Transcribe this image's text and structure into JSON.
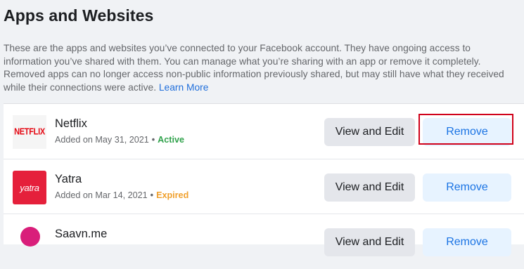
{
  "page": {
    "title": "Apps and Websites",
    "description": "These are the apps and websites you’ve connected to your Facebook account. They have ongoing access to information you’ve shared with them. You can manage what you’re sharing with an app or remove it completely. Removed apps can no longer access non-public information previously shared, but may still have what they received while their connections were active.",
    "learn_more": "Learn More"
  },
  "apps": [
    {
      "name": "Netflix",
      "logo_text": "NETFLIX",
      "added": "Added on May 31, 2021",
      "separator": "•",
      "status": "Active",
      "status_color": "#31a24c",
      "edit_label": "View and Edit",
      "remove_label": "Remove"
    },
    {
      "name": "Yatra",
      "logo_text": "yatra",
      "added": "Added on Mar 14, 2021",
      "separator": "•",
      "status": "Expired",
      "status_color": "#f0a12e",
      "edit_label": "View and Edit",
      "remove_label": "Remove"
    },
    {
      "name": "Saavn.me",
      "edit_label": "View and Edit",
      "remove_label": "Remove"
    }
  ],
  "colors": {
    "link": "#216fdb",
    "remove_button_bg": "#e7f3ff",
    "remove_button_text": "#1b74e4",
    "edit_button_bg": "#e4e6eb",
    "highlight": "#d0021b"
  }
}
